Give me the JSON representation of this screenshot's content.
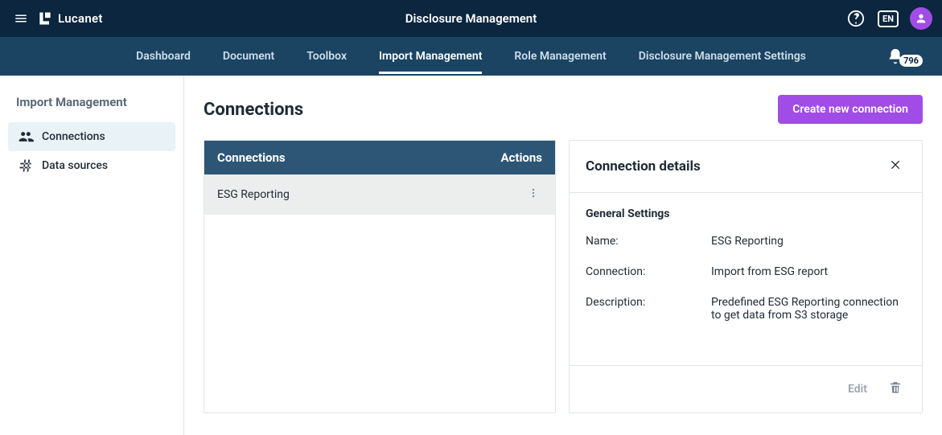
{
  "header": {
    "brand": "Lucanet",
    "title": "Disclosure Management",
    "language": "EN"
  },
  "nav": {
    "items": [
      "Dashboard",
      "Document",
      "Toolbox",
      "Import Management",
      "Role Management",
      "Disclosure Management Settings"
    ],
    "active_index": 3,
    "notifications_count": "796"
  },
  "sidebar": {
    "title": "Import Management",
    "items": [
      {
        "label": "Connections",
        "icon": "people"
      },
      {
        "label": "Data sources",
        "icon": "hash"
      }
    ],
    "active_index": 0
  },
  "main": {
    "title": "Connections",
    "create_button": "Create new connection",
    "table": {
      "columns": [
        "Connections",
        "Actions"
      ],
      "rows": [
        {
          "name": "ESG Reporting"
        }
      ]
    }
  },
  "details": {
    "title": "Connection details",
    "general_heading": "General Settings",
    "fields": {
      "name_label": "Name:",
      "name_value": "ESG Reporting",
      "connection_label": "Connection:",
      "connection_value": "Import from ESG report",
      "description_label": "Description:",
      "description_value": "Predefined ESG Reporting connection to get data from S3 storage"
    },
    "edit_label": "Edit"
  }
}
